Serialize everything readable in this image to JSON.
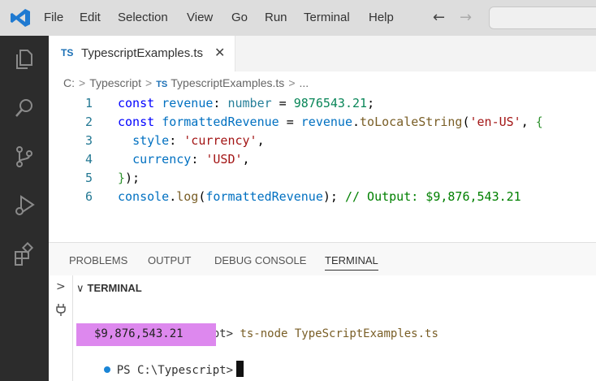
{
  "colors": {
    "menubar_bg": "#dddddd",
    "activitybar_bg": "#2c2c2c",
    "accent_blue": "#1a85d6",
    "highlight": "#dd88ee"
  },
  "menu": {
    "logo_icon": "vscode-logo-icon",
    "items": [
      "File",
      "Edit",
      "Selection",
      "View",
      "Go",
      "Run",
      "Terminal",
      "Help"
    ],
    "back_icon": "arrow-left-icon",
    "forward_icon": "arrow-right-icon"
  },
  "activitybar": {
    "icons": [
      "explorer-icon",
      "search-icon",
      "source-control-icon",
      "run-debug-icon",
      "extensions-icon"
    ]
  },
  "editor": {
    "tab": {
      "badge": "TS",
      "label": "TypescriptExamples.ts",
      "close": "✕"
    },
    "breadcrumb": [
      "C:",
      "Typescript",
      "TypescriptExamples.ts",
      "..."
    ],
    "breadcrumb_badge": "TS",
    "lines": [
      {
        "num": "1",
        "tokens": [
          [
            "k",
            "const "
          ],
          [
            "v",
            "revenue"
          ],
          [
            "p",
            ": "
          ],
          [
            "t",
            "number"
          ],
          [
            "p",
            " = "
          ],
          [
            "n",
            "9876543.21"
          ],
          [
            "p",
            ";"
          ]
        ]
      },
      {
        "num": "2",
        "tokens": [
          [
            "k",
            "const "
          ],
          [
            "v",
            "formattedRevenue"
          ],
          [
            "p",
            " = "
          ],
          [
            "v",
            "revenue"
          ],
          [
            "p",
            "."
          ],
          [
            "f",
            "toLocaleString"
          ],
          [
            "p",
            "("
          ],
          [
            "s",
            "'en-US'"
          ],
          [
            "p",
            ", "
          ],
          [
            "b",
            "{"
          ]
        ]
      },
      {
        "num": "3",
        "tokens": [
          [
            "p",
            "  "
          ],
          [
            "v",
            "style"
          ],
          [
            "p",
            ": "
          ],
          [
            "s",
            "'currency'"
          ],
          [
            "p",
            ","
          ]
        ]
      },
      {
        "num": "4",
        "tokens": [
          [
            "p",
            "  "
          ],
          [
            "v",
            "currency"
          ],
          [
            "p",
            ": "
          ],
          [
            "s",
            "'USD'"
          ],
          [
            "p",
            ","
          ]
        ]
      },
      {
        "num": "5",
        "tokens": [
          [
            "b",
            "}"
          ],
          [
            "p",
            ");"
          ]
        ]
      },
      {
        "num": "6",
        "tokens": [
          [
            "v",
            "console"
          ],
          [
            "p",
            "."
          ],
          [
            "f",
            "log"
          ],
          [
            "p",
            "("
          ],
          [
            "v",
            "formattedRevenue"
          ],
          [
            "p",
            "); "
          ],
          [
            "c",
            "// Output: $9,876,543.21"
          ]
        ]
      }
    ]
  },
  "panel": {
    "tabs": [
      "PROBLEMS",
      "OUTPUT",
      "DEBUG CONSOLE",
      "TERMINAL"
    ],
    "active_tab": "TERMINAL",
    "terminal_header": "TERMINAL",
    "side_chevron": ">",
    "prompt": "PS C:\\Typescript>",
    "command": "ts-node TypeScriptExamples.ts",
    "output": "$9,876,543.21"
  }
}
